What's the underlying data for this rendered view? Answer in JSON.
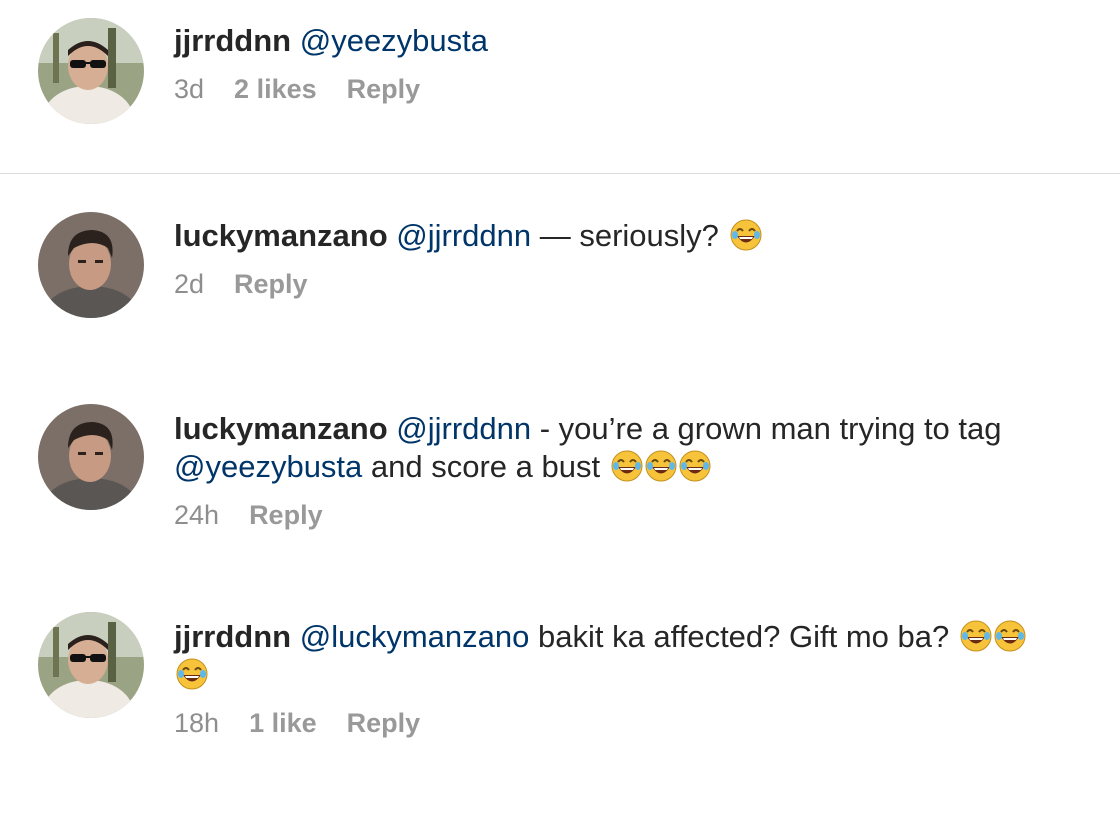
{
  "comments": [
    {
      "username": "jjrrddnn",
      "segments": [
        {
          "type": "mention",
          "text": "@yeezybusta"
        }
      ],
      "emoji_count": 0,
      "time": "3d",
      "likes": "2 likes",
      "reply": "Reply"
    },
    {
      "username": "luckymanzano",
      "segments": [
        {
          "type": "mention",
          "text": "@jjrrddnn"
        },
        {
          "type": "text",
          "text": " — seriously? "
        }
      ],
      "emoji_count": 1,
      "time": "2d",
      "likes": "",
      "reply": "Reply"
    },
    {
      "username": "luckymanzano",
      "segments": [
        {
          "type": "mention",
          "text": "@jjrrddnn"
        },
        {
          "type": "text",
          "text": " - you’re a grown man trying to tag "
        },
        {
          "type": "mention",
          "text": "@yeezybusta"
        },
        {
          "type": "text",
          "text": " and score a bust "
        }
      ],
      "emoji_count": 3,
      "time": "24h",
      "likes": "",
      "reply": "Reply"
    },
    {
      "username": "jjrrddnn",
      "segments": [
        {
          "type": "mention",
          "text": "@luckymanzano"
        },
        {
          "type": "text",
          "text": " bakit ka affected? Gift mo ba? "
        }
      ],
      "emoji_count": 3,
      "time": "18h",
      "likes": "1 like",
      "reply": "Reply"
    }
  ],
  "colors": {
    "mention": "#003569",
    "meta": "#8e8e8e",
    "divider": "#dbdbdb"
  },
  "icons": {
    "emoji": "laughing-with-tears-emoji-icon"
  }
}
